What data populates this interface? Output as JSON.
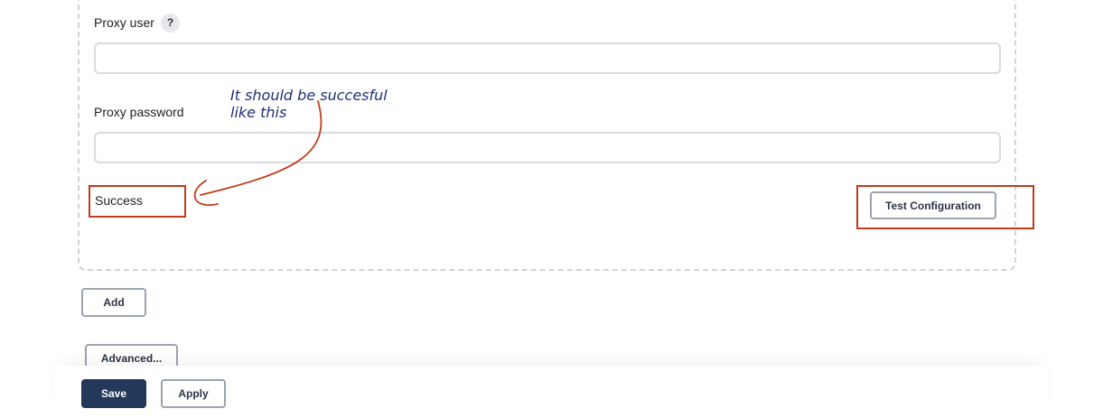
{
  "form": {
    "proxy_user": {
      "label": "Proxy user",
      "help": "?",
      "value": ""
    },
    "proxy_password": {
      "label": "Proxy password",
      "value": ""
    },
    "status_text": "Success",
    "test_button_label": "Test Configuration"
  },
  "actions": {
    "add_label": "Add",
    "advanced_label": "Advanced..."
  },
  "footer": {
    "save_label": "Save",
    "apply_label": "Apply"
  },
  "annotation": {
    "line1": "It should be succesful",
    "line2": "like this",
    "color": "#1e2f7a",
    "highlight_color": "#c23a1c"
  },
  "colors": {
    "primary": "#23385a",
    "border": "#d8dbe0"
  }
}
